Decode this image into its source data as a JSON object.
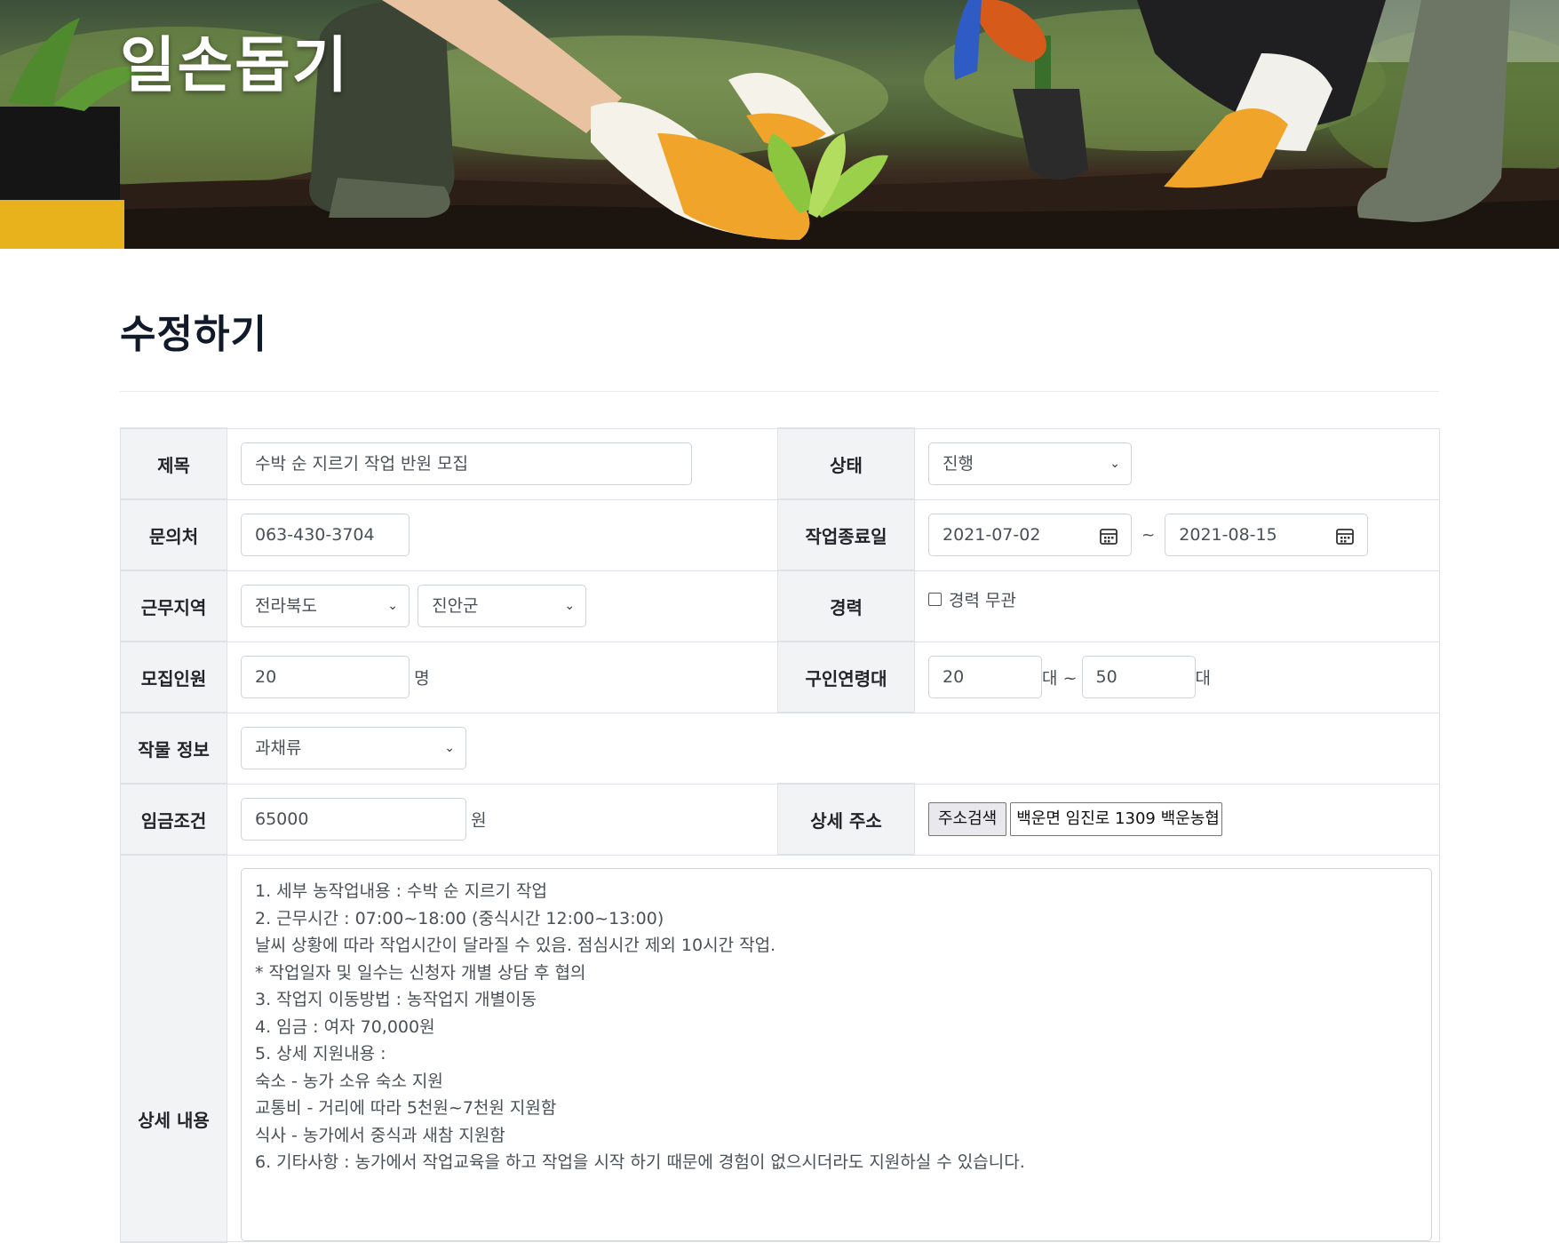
{
  "banner": {
    "title": "일손돕기"
  },
  "page": {
    "title": "수정하기"
  },
  "form": {
    "title_label": "제목",
    "title_value": "수박 순 지르기 작업 반원 모집",
    "status_label": "상태",
    "status_value": "진행",
    "contact_label": "문의처",
    "contact_value": "063-430-3704",
    "end_date_label": "작업종료일",
    "start_date": "2021-07-02",
    "date_sep": "~",
    "end_date": "2021-08-15",
    "region_label": "근무지역",
    "province_value": "전라북도",
    "county_value": "진안군",
    "career_label": "경력",
    "career_checkbox_label": "경력 무관",
    "recruit_label": "모집인원",
    "recruit_value": "20",
    "recruit_unit": "명",
    "age_label": "구인연령대",
    "age_min": "20",
    "age_min_unit": "대 ~",
    "age_max": "50",
    "age_max_unit": "대",
    "crop_label": "작물 정보",
    "crop_value": "과채류",
    "wage_label": "임금조건",
    "wage_value": "65000",
    "wage_unit": "원",
    "address_label": "상세 주소",
    "address_button": "주소검색",
    "address_value": "백운면 임진로 1309 백운농협",
    "detail_label": "상세 내용",
    "detail_lines": [
      "1. 세부 농작업내용 : 수박 순 지르기 작업",
      "2. 근무시간 : 07:00~18:00 (중식시간 12:00~13:00)",
      "날씨 상황에 따라 작업시간이 달라질 수 있음. 점심시간 제외 10시간 작업.",
      "* 작업일자 및 일수는 신청자 개별 상담 후 협의",
      "3. 작업지 이동방법 : 농작업지 개별이동",
      "4. 임금 : 여자 70,000원",
      "5. 상세 지원내용 :",
      "숙소 - 농가 소유 숙소 지원",
      "교통비 - 거리에 따라 5천원~7천원 지원함",
      "식사 - 농가에서 중식과 새참 지원함",
      "6. 기타사항 : 농가에서 작업교육을 하고 작업을 시작 하기 때문에 경험이 없으시더라도 지원하실 수 있습니다."
    ]
  },
  "colors": {
    "header_cell_bg": "#f1f3f5",
    "border": "#dee2e6",
    "title_text": "#111a2b"
  },
  "icons": [
    "calendar-icon",
    "chevron-down-icon"
  ]
}
